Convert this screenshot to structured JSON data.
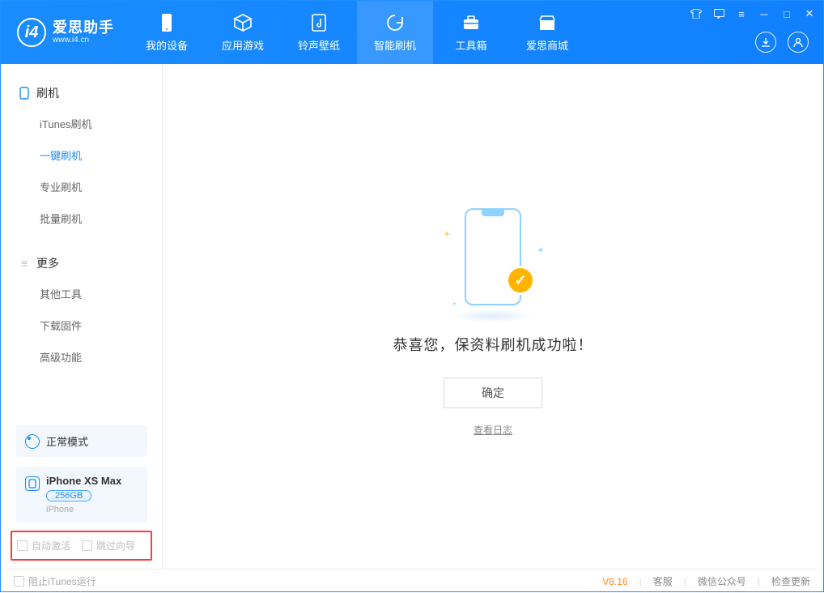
{
  "app": {
    "title": "爱思助手",
    "subtitle": "www.i4.cn"
  },
  "tabs": {
    "device": "我的设备",
    "apps": "应用游戏",
    "ring": "铃声壁纸",
    "flash": "智能刷机",
    "tools": "工具箱",
    "store": "爱思商城"
  },
  "sidebar": {
    "group1": {
      "title": "刷机",
      "items": {
        "itunes": "iTunes刷机",
        "onekey": "一键刷机",
        "pro": "专业刷机",
        "batch": "批量刷机"
      }
    },
    "group2": {
      "title": "更多",
      "items": {
        "other": "其他工具",
        "fw": "下载固件",
        "adv": "高级功能"
      }
    }
  },
  "mode": {
    "label": "正常模式"
  },
  "device": {
    "name": "iPhone XS Max",
    "capacity": "256GB",
    "type": "iPhone"
  },
  "options": {
    "auto_activate": "自动激活",
    "skip_guide": "跳过向导"
  },
  "main": {
    "success_text": "恭喜您，保资料刷机成功啦！",
    "ok_label": "确定",
    "log_link": "查看日志"
  },
  "footer": {
    "block_itunes": "阻止iTunes运行",
    "version": "V8.16",
    "support": "客服",
    "wechat": "微信公众号",
    "update": "检查更新"
  }
}
